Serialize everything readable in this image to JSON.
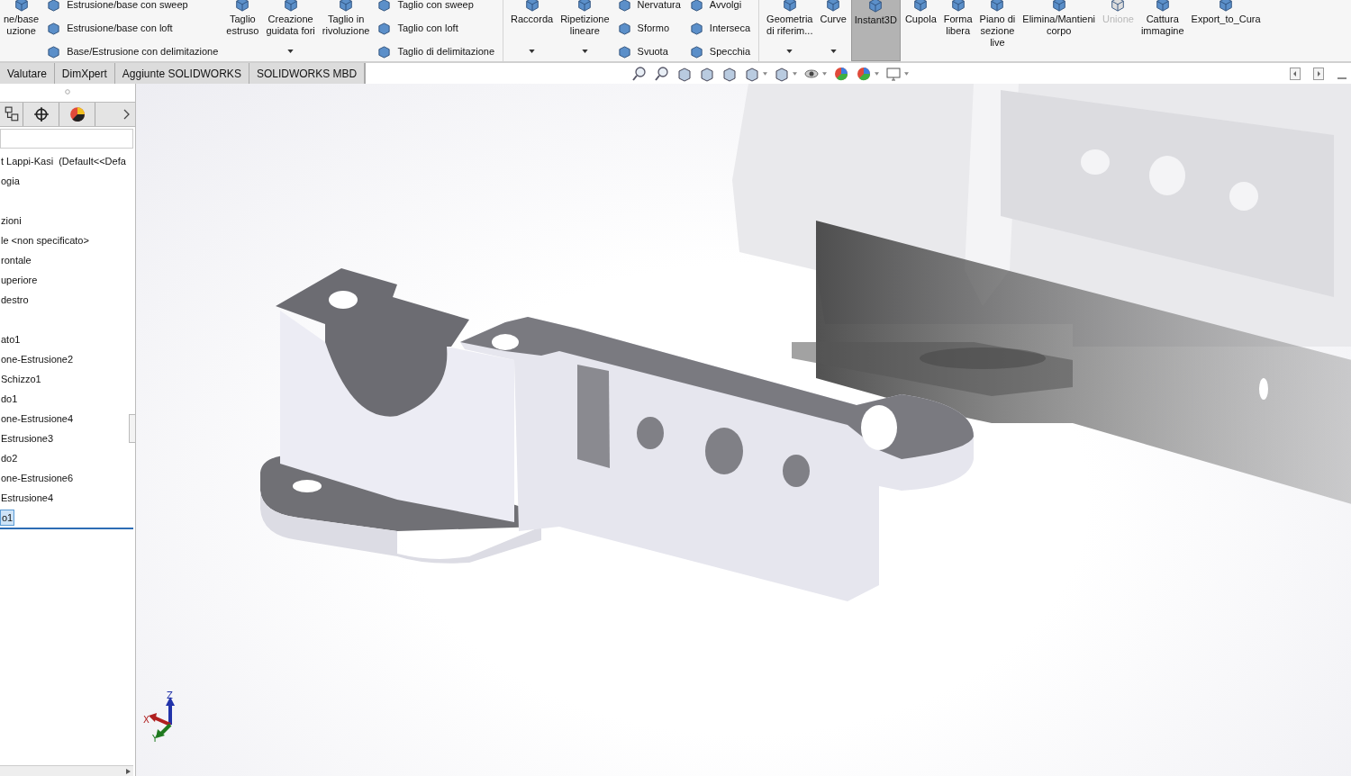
{
  "ribbon": {
    "items": [
      {
        "kind": "big",
        "label": "ne/base\nuzione",
        "caret": false,
        "on": false,
        "disabled": false
      },
      {
        "kind": "stack",
        "rows": [
          "Estrusione/base con sweep",
          "Estrusione/base con loft",
          "Base/Estrusione con delimitazione"
        ]
      },
      {
        "kind": "big",
        "label": "Taglio\nestruso",
        "caret": false,
        "on": false,
        "disabled": false
      },
      {
        "kind": "big",
        "label": "Creazione\nguidata fori",
        "caret": true,
        "on": false,
        "disabled": false
      },
      {
        "kind": "big",
        "label": "Taglio in\nrivoluzione",
        "caret": false,
        "on": false,
        "disabled": false
      },
      {
        "kind": "stack",
        "rows": [
          "Taglio con sweep",
          "Taglio con loft",
          "Taglio di delimitazione"
        ]
      },
      {
        "kind": "separator"
      },
      {
        "kind": "big",
        "label": "Raccorda",
        "caret": true,
        "on": false,
        "disabled": false
      },
      {
        "kind": "big",
        "label": "Ripetizione\nlineare",
        "caret": true,
        "on": false,
        "disabled": false
      },
      {
        "kind": "stack",
        "rows": [
          "Nervatura",
          "Sformo",
          "Svuota"
        ]
      },
      {
        "kind": "stack",
        "rows": [
          "Avvolgi",
          "Interseca",
          "Specchia"
        ]
      },
      {
        "kind": "separator"
      },
      {
        "kind": "big",
        "label": "Geometria\ndi riferim...",
        "caret": true,
        "on": false,
        "disabled": false
      },
      {
        "kind": "big",
        "label": "Curve",
        "caret": true,
        "on": false,
        "disabled": false
      },
      {
        "kind": "big",
        "label": "Instant3D",
        "caret": false,
        "on": true,
        "disabled": false
      },
      {
        "kind": "big",
        "label": "Cupola",
        "caret": false,
        "on": false,
        "disabled": false
      },
      {
        "kind": "big",
        "label": "Forma\nlibera",
        "caret": false,
        "on": false,
        "disabled": false
      },
      {
        "kind": "big",
        "label": "Piano di\nsezione\nlive",
        "caret": false,
        "on": false,
        "disabled": false
      },
      {
        "kind": "big",
        "label": "Elimina/Mantieni\ncorpo",
        "caret": false,
        "on": false,
        "disabled": false
      },
      {
        "kind": "big",
        "label": "Unione",
        "caret": false,
        "on": false,
        "disabled": true
      },
      {
        "kind": "big",
        "label": "Cattura\nimmagine",
        "caret": false,
        "on": false,
        "disabled": false
      },
      {
        "kind": "big",
        "label": "Export_to_Cura",
        "caret": false,
        "on": false,
        "disabled": false
      }
    ]
  },
  "tabs": [
    {
      "label": "Valutare",
      "selected": false
    },
    {
      "label": "DimXpert",
      "selected": false
    },
    {
      "label": "Aggiunte SOLIDWORKS",
      "selected": false
    },
    {
      "label": "SOLIDWORKS MBD",
      "selected": false
    }
  ],
  "tree": {
    "groups": [
      {
        "items": [
          {
            "label": "t Lappi-Kasi  (Default<<Defa",
            "selected": false
          },
          {
            "label": "ogia",
            "selected": false
          }
        ]
      },
      {
        "items": [
          {
            "label": "zioni",
            "selected": false
          },
          {
            "label": "le <non specificato>",
            "selected": false
          },
          {
            "label": "rontale",
            "selected": false
          },
          {
            "label": "uperiore",
            "selected": false
          },
          {
            "label": "destro",
            "selected": false
          }
        ]
      },
      {
        "items": [
          {
            "label": "ato1",
            "selected": false
          },
          {
            "label": "one-Estrusione2",
            "selected": false
          },
          {
            "label": "Schizzo1",
            "selected": false
          },
          {
            "label": "do1",
            "selected": false
          },
          {
            "label": "one-Estrusione4",
            "selected": false
          },
          {
            "label": "Estrusione3",
            "selected": false
          },
          {
            "label": "do2",
            "selected": false
          },
          {
            "label": "one-Estrusione6",
            "selected": false
          },
          {
            "label": "Estrusione4",
            "selected": false
          },
          {
            "label": "o1",
            "selected": true
          }
        ]
      }
    ]
  },
  "triad": {
    "labels": [
      "Z",
      "X",
      "Y"
    ]
  }
}
